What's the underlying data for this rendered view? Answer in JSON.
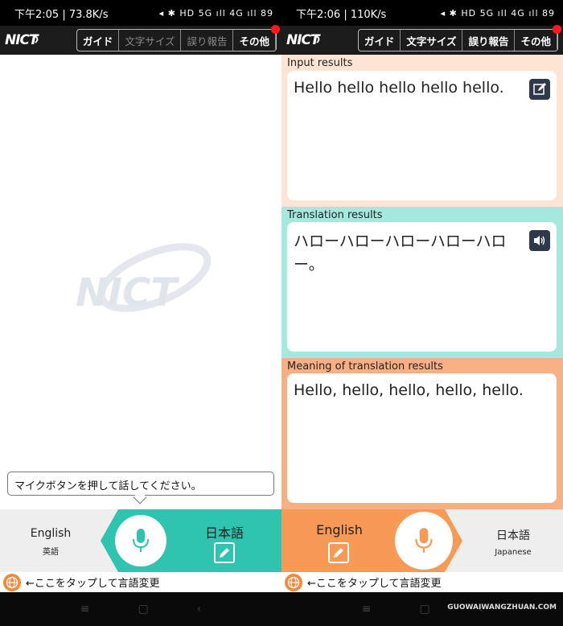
{
  "left": {
    "status": {
      "time_speed": "下午2:05 | 73.8K/s",
      "icons": "◂ ✱ HD 5G ıll 4G ıll 89"
    },
    "appbar": {
      "logo": "NICT",
      "menu": [
        "ガイド",
        "文字サイズ",
        "誤り報告",
        "その他"
      ]
    },
    "watermark": "NICT",
    "hint": "マイクボタンを押して話してください。",
    "lang_left": {
      "main": "English",
      "sub": "英語"
    },
    "lang_right": {
      "main": "日本語"
    },
    "footer": "←ここをタップして言語変更"
  },
  "right": {
    "status": {
      "time_speed": "下午2:06 | 110K/s",
      "icons": "◂ ✱ HD 5G ıll 4G ıll 89"
    },
    "appbar": {
      "logo": "NICT",
      "menu": [
        "ガイド",
        "文字サイズ",
        "誤り報告",
        "その他"
      ]
    },
    "input": {
      "label": "Input results",
      "text": "Hello hello hello hello hello."
    },
    "translation": {
      "label": "Translation results",
      "text": "ハローハローハローハローハロー。"
    },
    "meaning": {
      "label": "Meaning of translation results",
      "text": "Hello, hello, hello, hello, hello."
    },
    "lang_left": {
      "main": "English"
    },
    "lang_right": {
      "main": "日本語",
      "sub": "Japanese"
    },
    "footer": "←ここをタップして言語変更",
    "watermark_site": "GUOWAIWANGZHUAN.COM"
  },
  "colors": {
    "teal": "#2ec4b0",
    "orange": "#f79a55",
    "input_bg": "#fde4d3",
    "translation_bg": "#a5e8dd",
    "meaning_bg": "#f7b084"
  }
}
